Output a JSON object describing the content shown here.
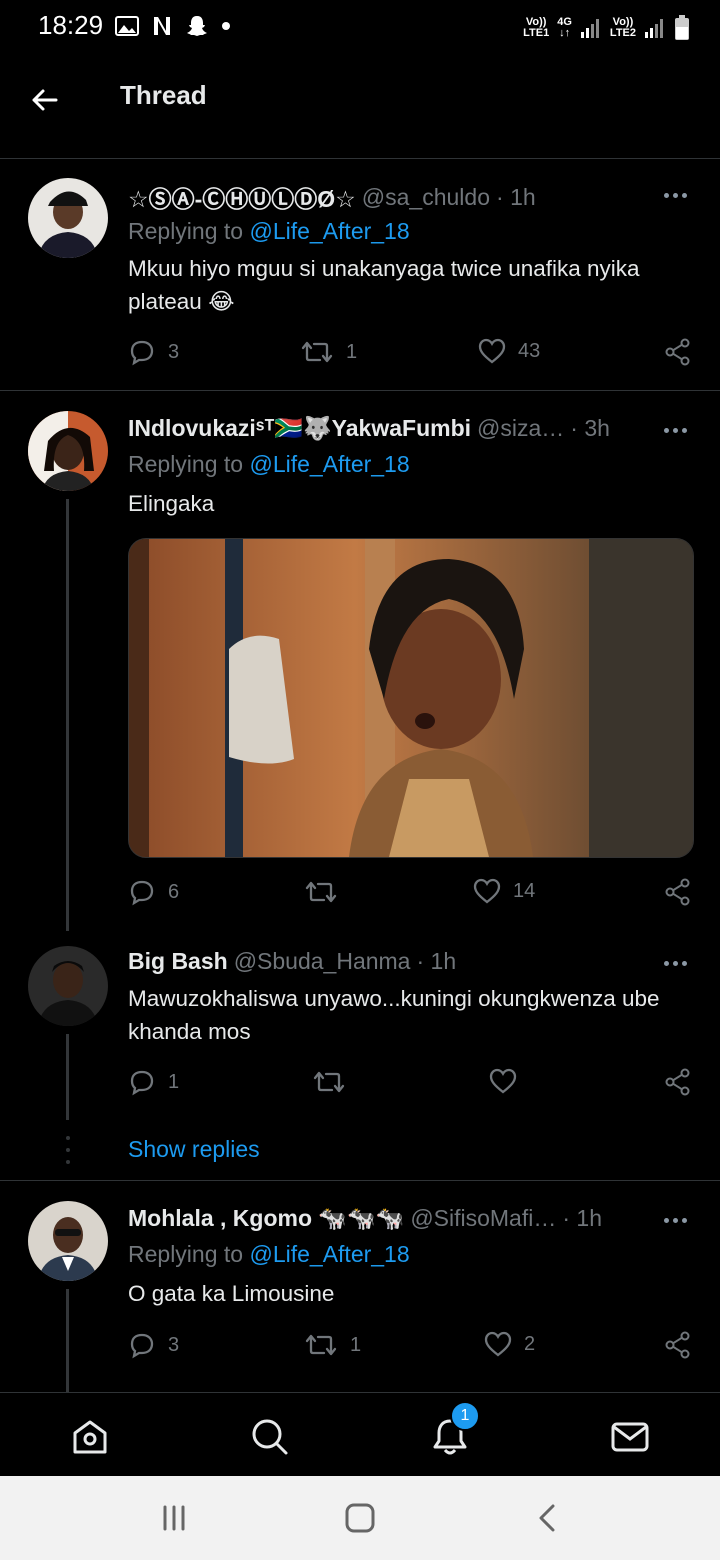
{
  "status_bar": {
    "time": "18:29",
    "net1_top": "Vo))",
    "net1_bottom": "LTE1",
    "net_type": "4G",
    "net2_top": "Vo))",
    "net2_bottom": "LTE2"
  },
  "header": {
    "title": "Thread"
  },
  "tweets": [
    {
      "display_name": "☆ⓈⒶ-ⒸⒽⓊⓁⒹØ☆",
      "handle": "@sa_chuldo",
      "time": "· 1h",
      "replying_prefix": "Replying to",
      "replying_to": "@Life_After_18",
      "text": "Mkuu hiyo mguu si unakanyaga twice unafika nyika plateau 😂",
      "replies": "3",
      "retweets": "1",
      "likes": "43"
    },
    {
      "display_name": "INdlovukaziˢᵀ🇿🇦🐺YakwaFumbi",
      "handle": "@siza…",
      "time": "· 3h",
      "replying_prefix": "Replying to",
      "replying_to": "@Life_After_18",
      "text": "Elingaka",
      "replies": "6",
      "retweets": "",
      "likes": "14"
    },
    {
      "display_name": "Big Bash",
      "handle": "@Sbuda_Hanma",
      "time": "· 1h",
      "text": "Mawuzokhaliswa unyawo...kuningi okungkwenza ube khanda mos",
      "replies": "1",
      "retweets": "",
      "likes": "",
      "show_replies": "Show replies"
    },
    {
      "display_name": "Mohlala , Kgomo 🐄🐄🐄",
      "handle": "@SifisoMafi…",
      "time": "· 1h",
      "replying_prefix": "Replying to",
      "replying_to": "@Life_After_18",
      "text": "O gata ka Limousine",
      "replies": "3",
      "retweets": "1",
      "likes": "2"
    }
  ],
  "bottom_nav": {
    "notification_badge": "1"
  },
  "colors": {
    "accent": "#1d9bf0",
    "background": "#000000",
    "muted": "#71767b"
  }
}
